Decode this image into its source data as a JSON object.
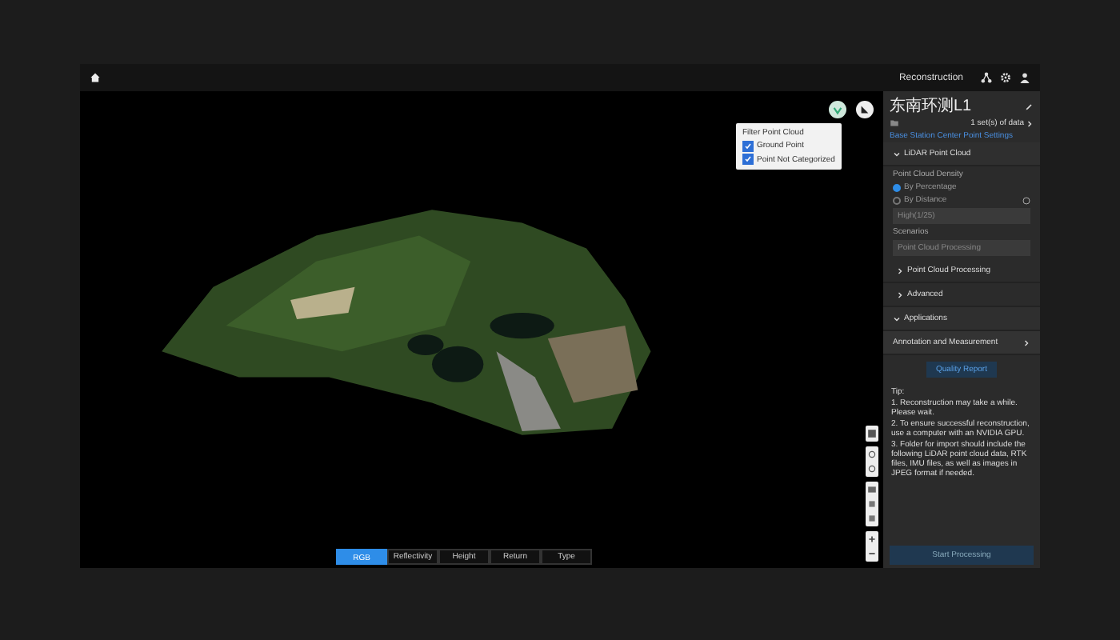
{
  "topbar": {
    "title": "Reconstruction"
  },
  "viewport": {
    "filter": {
      "title": "Filter Point Cloud",
      "options": [
        {
          "label": "Ground Point",
          "checked": true
        },
        {
          "label": "Point Not Categorized",
          "checked": true
        }
      ]
    },
    "color_tabs": [
      {
        "label": "RGB",
        "selected": true
      },
      {
        "label": "Reflectivity",
        "selected": false
      },
      {
        "label": "Height",
        "selected": false
      },
      {
        "label": "Return",
        "selected": false
      },
      {
        "label": "Type",
        "selected": false
      }
    ]
  },
  "panel": {
    "title": "东南环测L1",
    "data_count": "1 set(s) of data",
    "link": "Base Station Center Point Settings",
    "lidar": {
      "label": "LiDAR Point Cloud",
      "expanded": true
    },
    "density": {
      "label": "Point Cloud Density",
      "options": [
        {
          "label": "By Percentage",
          "selected": true
        },
        {
          "label": "By Distance",
          "selected": false
        }
      ],
      "value": "High(1/25)"
    },
    "scenarios": {
      "label": "Scenarios",
      "value": "Point Cloud Processing"
    },
    "sections": [
      {
        "label": "Point Cloud Processing",
        "expanded": false
      },
      {
        "label": "Advanced",
        "expanded": false
      },
      {
        "label": "Applications",
        "expanded": true
      }
    ],
    "annotation": "Annotation and Measurement",
    "quality_button": "Quality Report",
    "tip_title": "Tip:",
    "tips": [
      "1. Reconstruction may take a while. Please wait.",
      "2. To ensure successful reconstruction, use a computer with an NVIDIA GPU.",
      "3. Folder for import should include the following LiDAR point cloud data, RTK files, IMU files, as well as images in JPEG format if needed."
    ],
    "start_button": "Start Processing"
  }
}
